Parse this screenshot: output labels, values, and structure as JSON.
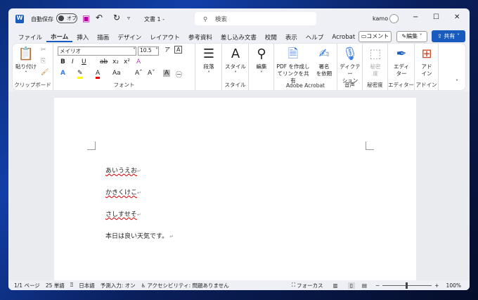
{
  "titlebar": {
    "autosave_label": "自動保存",
    "autosave_state": "オフ",
    "doc_title": "文書 1  -",
    "search_placeholder": "検索",
    "user": "kamo"
  },
  "menu": {
    "tabs": [
      "ファイル",
      "ホーム",
      "挿入",
      "描画",
      "デザイン",
      "レイアウト",
      "参考資料",
      "差し込み文書",
      "校閲",
      "表示",
      "ヘルプ",
      "Acrobat"
    ],
    "active": "ホーム",
    "comment": "コメント",
    "edit": "編集",
    "share": "共有"
  },
  "ribbon": {
    "clipboard": {
      "paste": "貼り付け",
      "label": "クリップボード"
    },
    "font": {
      "name": "メイリオ",
      "size": "10.5",
      "label": "フォント",
      "bold": "B",
      "italic": "I",
      "underline": "U",
      "sub": "x₂",
      "sup": "x²",
      "case": "Aa"
    },
    "paragraph": {
      "label": "段落"
    },
    "styles": {
      "button": "スタイル",
      "label": "スタイル"
    },
    "editing": {
      "label": "編集"
    },
    "acrobat": {
      "pdf": "PDF を作成し",
      "pdf2": "てリンクを共有",
      "sign": "署名",
      "sign2": "を依頼",
      "label": "Adobe Acrobat"
    },
    "voice": {
      "dictate": "ディクテー",
      "dictate2": "ション",
      "label": "音声"
    },
    "sensitivity": {
      "button": "秘密",
      "button2": "度",
      "label": "秘密度"
    },
    "editor": {
      "button": "エディ",
      "button2": "ター",
      "label": "エディター"
    },
    "addins": {
      "button": "アド",
      "button2": "イン",
      "label": "アドイン"
    }
  },
  "document": {
    "lines": [
      "あいうえお",
      "かきくけこ",
      "さしすせそ",
      "本日は良い天気です。"
    ]
  },
  "status": {
    "page": "1/1 ページ",
    "words": "25 単語",
    "language": "日本語",
    "predict": "予測入力: オン",
    "accessibility": "アクセシビリティ: 問題ありません",
    "focus": "フォーカス",
    "zoom": "100%",
    "zoom_value": 100
  }
}
